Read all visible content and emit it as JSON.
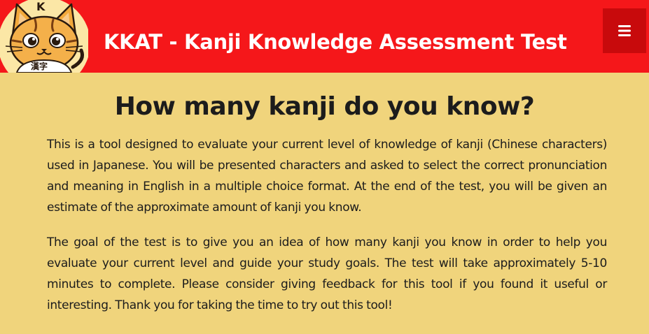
{
  "header": {
    "title": "KKAT - Kanji Knowledge Assessment Test",
    "logo_label": "漢字",
    "logo_letter": "K",
    "menu_icon": "hamburger-menu-icon"
  },
  "main": {
    "heading": "How many kanji do you know?",
    "paragraphs": [
      "This is a tool designed to evaluate your current level of knowledge of kanji (Chinese characters) used in Japanese. You will be presented characters and asked to select the correct pronunciation and meaning in English in a multiple choice format. At the end of the test, you will be given an estimate of the approximate amount of kanji you know.",
      "The goal of the test is to give you an idea of how many kanji you know in order to help you evaluate your current level and guide your study goals. The test will take approximately 5-10 minutes to complete. Please consider giving feedback for this tool if you found it useful or interesting. Thank you for taking the time to try out this tool!"
    ]
  },
  "colors": {
    "header_bg": "#f5171a",
    "menu_button_bg": "#c80a0c",
    "page_bg": "#f0d47c",
    "text": "#1c1c1c"
  }
}
